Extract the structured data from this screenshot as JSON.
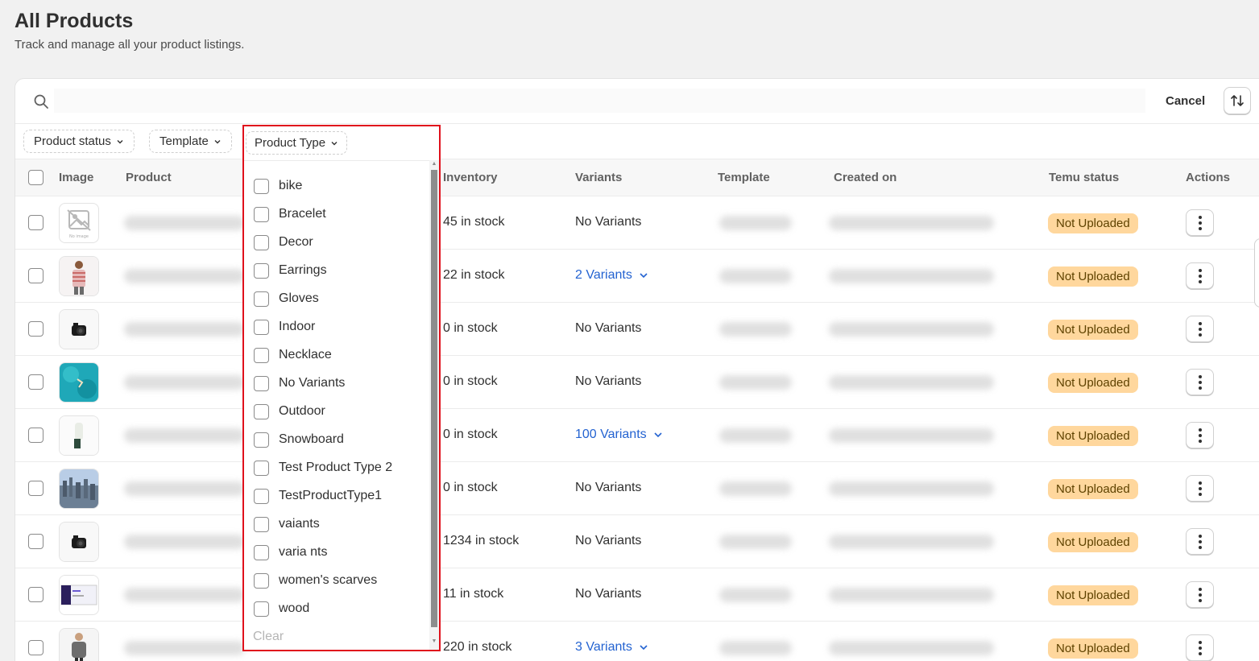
{
  "page": {
    "title": "All Products",
    "subtitle": "Track and manage all your product listings."
  },
  "search": {
    "placeholder": "",
    "cancel_label": "Cancel"
  },
  "filters": {
    "product_status": "Product status",
    "template": "Template",
    "product_type": "Product Type"
  },
  "table": {
    "headers": {
      "image": "Image",
      "product": "Product",
      "inventory": "Inventory",
      "variants": "Variants",
      "template": "Template",
      "created_on": "Created on",
      "temu_status": "Temu status",
      "actions": "Actions"
    },
    "rows": [
      {
        "inventory": "45 in stock",
        "variants": "No Variants",
        "variants_link": false,
        "status": "Not Uploaded",
        "thumb": "no-image"
      },
      {
        "inventory": "22 in stock",
        "variants": "2 Variants",
        "variants_link": true,
        "status": "Not Uploaded",
        "thumb": "person-shirt"
      },
      {
        "inventory": "0 in stock",
        "variants": "No Variants",
        "variants_link": false,
        "status": "Not Uploaded",
        "thumb": "camera"
      },
      {
        "inventory": "0 in stock",
        "variants": "No Variants",
        "variants_link": false,
        "status": "Not Uploaded",
        "thumb": "aerial-sea"
      },
      {
        "inventory": "0 in stock",
        "variants": "100 Variants",
        "variants_link": true,
        "status": "Not Uploaded",
        "thumb": "white-product"
      },
      {
        "inventory": "0 in stock",
        "variants": "No Variants",
        "variants_link": false,
        "status": "Not Uploaded",
        "thumb": "city-skyline"
      },
      {
        "inventory": "1234 in stock",
        "variants": "No Variants",
        "variants_link": false,
        "status": "Not Uploaded",
        "thumb": "camera"
      },
      {
        "inventory": "11 in stock",
        "variants": "No Variants",
        "variants_link": false,
        "status": "Not Uploaded",
        "thumb": "screenshot"
      },
      {
        "inventory": "220 in stock",
        "variants": "3 Variants",
        "variants_link": true,
        "status": "Not Uploaded",
        "thumb": "person-hoodie"
      }
    ]
  },
  "product_type_dropdown": {
    "options": [
      "bike",
      "Bracelet",
      "Decor",
      "Earrings",
      "Gloves",
      "Indoor",
      "Necklace",
      "No Variants",
      "Outdoor",
      "Snowboard",
      "Test Product Type 2",
      "TestProductType1",
      "vaiants",
      "varia nts",
      "women's scarves",
      "wood"
    ],
    "clear_label": "Clear"
  },
  "colors": {
    "badge_bg": "#ffd79d",
    "link": "#2463d1",
    "highlight_border": "#e0111c"
  }
}
